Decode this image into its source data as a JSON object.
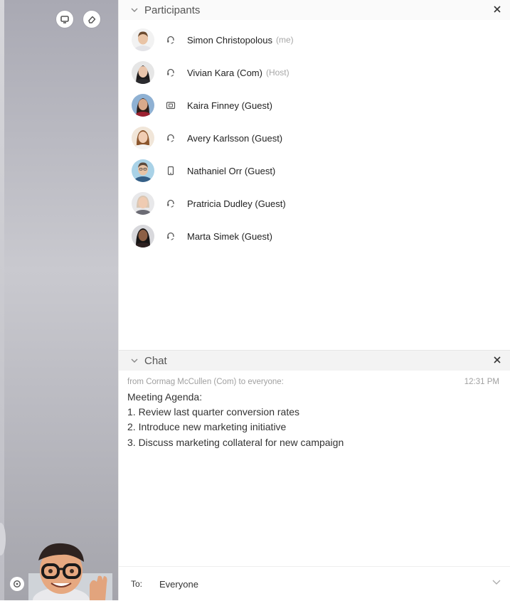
{
  "participants": {
    "title": "Participants",
    "items": [
      {
        "name": "Simon Christopolous",
        "tag": "(me)",
        "status_icon": "headset-icon",
        "hair": "#6b4a2f",
        "skin": "#e9c4a6",
        "shirt": "#e3e3e7",
        "bg": "#f2f2f2"
      },
      {
        "name": "Vivian Kara (Com)",
        "tag": "(Host)",
        "status_icon": "headset-icon",
        "hair": "#1f1c1c",
        "skin": "#eac5ab",
        "shirt": "#2b2b2f",
        "bg": "#e6e6e6"
      },
      {
        "name": "Kaira Finney (Guest)",
        "tag": "",
        "status_icon": "video-icon",
        "hair": "#2c1d17",
        "skin": "#d9a98b",
        "shirt": "#9c2130",
        "bg": "#8fb1d3"
      },
      {
        "name": "Avery Karlsson (Guest)",
        "tag": "",
        "status_icon": "headset-icon",
        "hair": "#8b552c",
        "skin": "#f0cdb4",
        "shirt": "#f4f4f4",
        "bg": "#f1e6d9"
      },
      {
        "name": "Nathaniel Orr (Guest)",
        "tag": "",
        "status_icon": "phone-icon",
        "hair": "#5c4a3c",
        "skin": "#e7c3a6",
        "shirt": "#355f86",
        "bg": "#a9d2e7"
      },
      {
        "name": "Pratricia Dudley (Guest)",
        "tag": "",
        "status_icon": "headset-icon",
        "hair": "#d9c7b4",
        "skin": "#efcbb2",
        "shirt": "#6b6b74",
        "bg": "#e8e8ea"
      },
      {
        "name": "Marta Simek (Guest)",
        "tag": "",
        "status_icon": "headset-icon",
        "hair": "#161414",
        "skin": "#8c5f45",
        "shirt": "#2d2020",
        "bg": "#d8d8dc"
      }
    ]
  },
  "chat": {
    "title": "Chat",
    "from": "from Cormag McCullen (Com) to everyone:",
    "time": "12:31 PM",
    "lines": [
      "Meeting Agenda:",
      "1. Review last quarter conversion rates",
      "2. Introduce new marketing initiative",
      "3. Discuss marketing collateral for new campaign"
    ],
    "to_label": "To:",
    "to_value": "Everyone"
  },
  "colors": {
    "accent": "#222222",
    "muted": "#a0a0a0",
    "panel_bg": "#ffffff"
  }
}
